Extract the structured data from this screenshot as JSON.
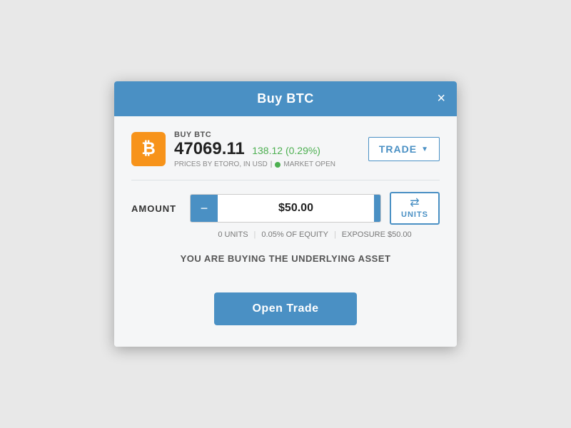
{
  "modal": {
    "title": "Buy BTC",
    "close_label": "×"
  },
  "asset": {
    "buy_label": "BUY BTC",
    "price": "47069.11",
    "change": "138.12 (0.29%)",
    "meta": "PRICES BY ETORO, IN USD",
    "market_status": "MARKET OPEN",
    "icon": "₿"
  },
  "trade_dropdown": {
    "label": "TRADE",
    "arrow": "▼"
  },
  "amount": {
    "label": "AMOUNT",
    "value": "$50.00",
    "minus": "−",
    "plus": "+"
  },
  "units_button": {
    "icon": "⇄",
    "label": "UNITS"
  },
  "stats": {
    "units": "0 UNITS",
    "equity": "0.05% OF EQUITY",
    "exposure": "EXPOSURE $50.00"
  },
  "underlying_msg": "YOU ARE BUYING THE UNDERLYING ASSET",
  "open_trade_btn": "Open Trade"
}
